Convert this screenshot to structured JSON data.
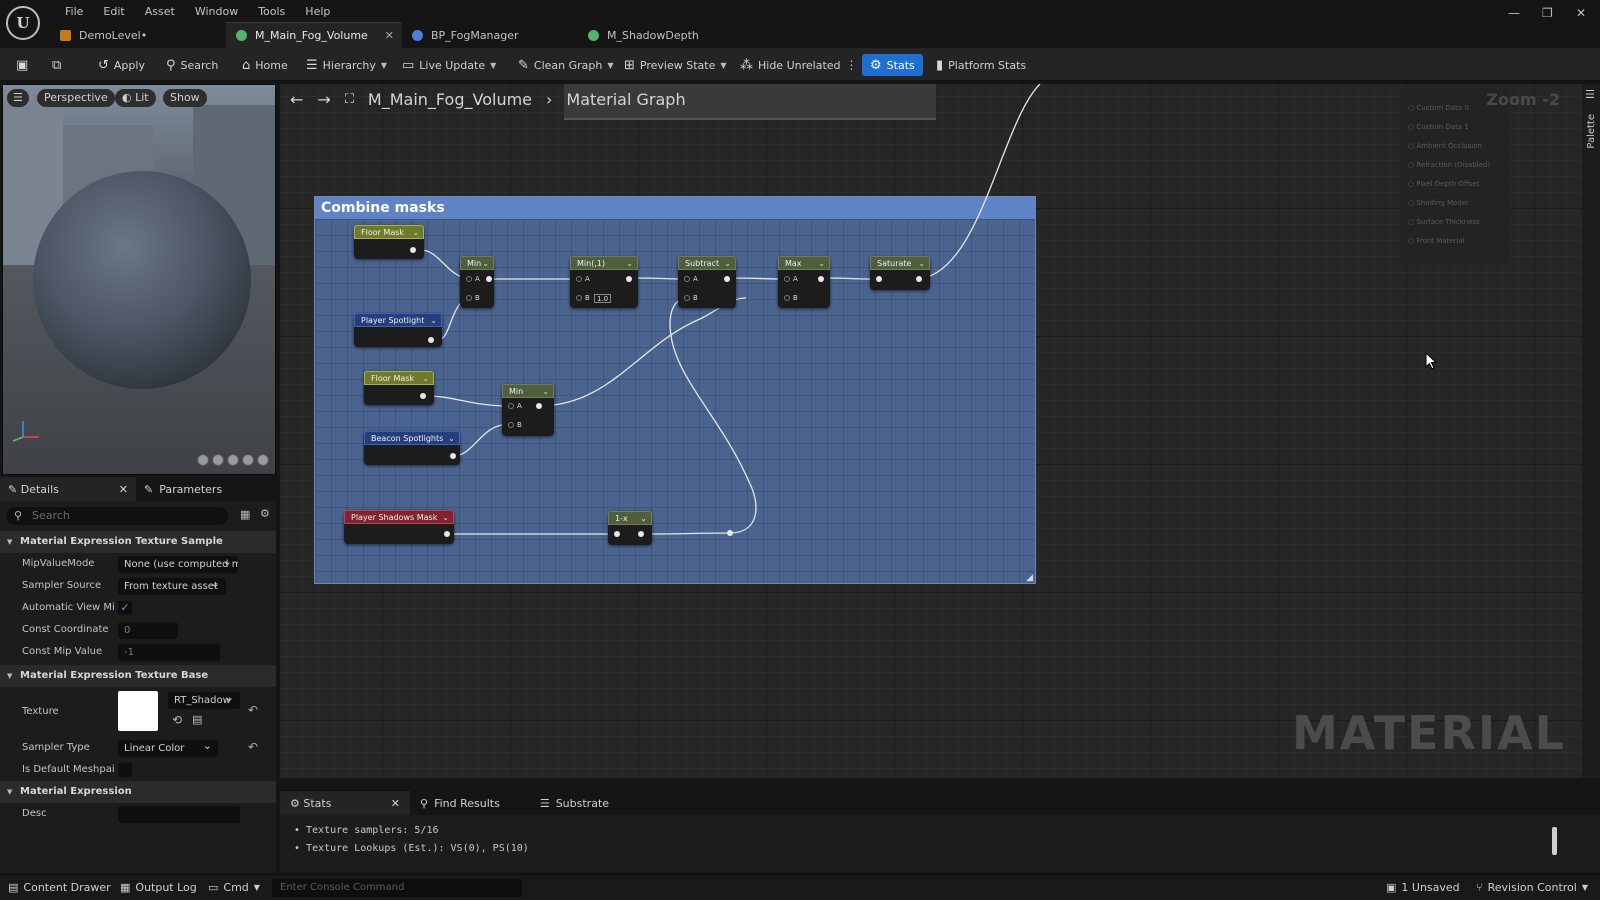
{
  "menu": [
    "File",
    "Edit",
    "Asset",
    "Window",
    "Tools",
    "Help"
  ],
  "tabs": [
    {
      "label": "DemoLevel•",
      "color": "#c77a1c"
    },
    {
      "label": "M_Main_Fog_Volume",
      "color": "#55b36a",
      "active": true
    },
    {
      "label": "BP_FogManager",
      "color": "#4f7fd6"
    },
    {
      "label": "M_ShadowDepth",
      "color": "#55b36a"
    }
  ],
  "toolbar": {
    "apply": "Apply",
    "search": "Search",
    "home": "Home",
    "hierarchy": "Hierarchy",
    "live_update": "Live Update",
    "clean_graph": "Clean Graph",
    "preview_state": "Preview State",
    "hide_unrelated": "Hide Unrelated",
    "stats": "Stats",
    "platform_stats": "Platform Stats"
  },
  "viewport": {
    "perspective": "Perspective",
    "lit": "Lit",
    "show": "Show"
  },
  "details": {
    "tab_details": "Details",
    "tab_parameters": "Parameters",
    "search_placeholder": "Search",
    "sections": {
      "texture_sample": "Material Expression Texture Sample",
      "texture_base": "Material Expression Texture Base",
      "expression": "Material Expression"
    },
    "props": {
      "mip_value_mode": {
        "label": "MipValueMode",
        "value": "None (use computed m"
      },
      "sampler_source": {
        "label": "Sampler Source",
        "value": "From texture asset"
      },
      "automatic_view_mip": {
        "label": "Automatic View Mi..."
      },
      "const_coordinate": {
        "label": "Const Coordinate",
        "value": "0"
      },
      "const_mip_value": {
        "label": "Const Mip Value",
        "value": "-1"
      },
      "texture": {
        "label": "Texture",
        "value": "RT_Shadow"
      },
      "sampler_type": {
        "label": "Sampler Type",
        "value": "Linear Color"
      },
      "is_default_meshpaint": {
        "label": "Is Default Meshpai..."
      },
      "desc": {
        "label": "Desc",
        "value": ""
      }
    }
  },
  "graph": {
    "breadcrumb_asset": "M_Main_Fog_Volume",
    "breadcrumb_graph": "Material Graph",
    "zoom": "Zoom -2",
    "watermark": "MATERIAL",
    "palette": "Palette",
    "comment_title": "Combine masks",
    "result_pins": [
      "Custom Data 0",
      "Custom Data 1",
      "Ambient Occlusion",
      "Refraction (Disabled)",
      "Pixel Depth Offset",
      "Shading Model",
      "Surface Thickness",
      "Front Material"
    ],
    "nodes": {
      "floor_mask_1": "Floor Mask",
      "player_spotlight": "Player Spotlight",
      "floor_mask_2": "Floor Mask",
      "beacon_spotlights": "Beacon Spotlights",
      "player_shadows_mask": "Player Shadows Mask",
      "min_1": "Min",
      "min_2": "Min(,1)",
      "subtract": "Subtract",
      "max": "Max",
      "saturate": "Saturate",
      "min_3": "Min",
      "one_minus": "1-x"
    },
    "pins": {
      "a": "A",
      "b": "B",
      "const_one": "1.0"
    }
  },
  "stats": {
    "tab_stats": "Stats",
    "tab_find": "Find Results",
    "tab_substrate": "Substrate",
    "lines": [
      "Texture samplers: 5/16",
      "Texture Lookups (Est.): VS(0), PS(10)"
    ]
  },
  "statusbar": {
    "content_drawer": "Content Drawer",
    "output_log": "Output Log",
    "cmd": "Cmd",
    "console_placeholder": "Enter Console Command",
    "unsaved": "1 Unsaved",
    "revision_control": "Revision Control"
  }
}
